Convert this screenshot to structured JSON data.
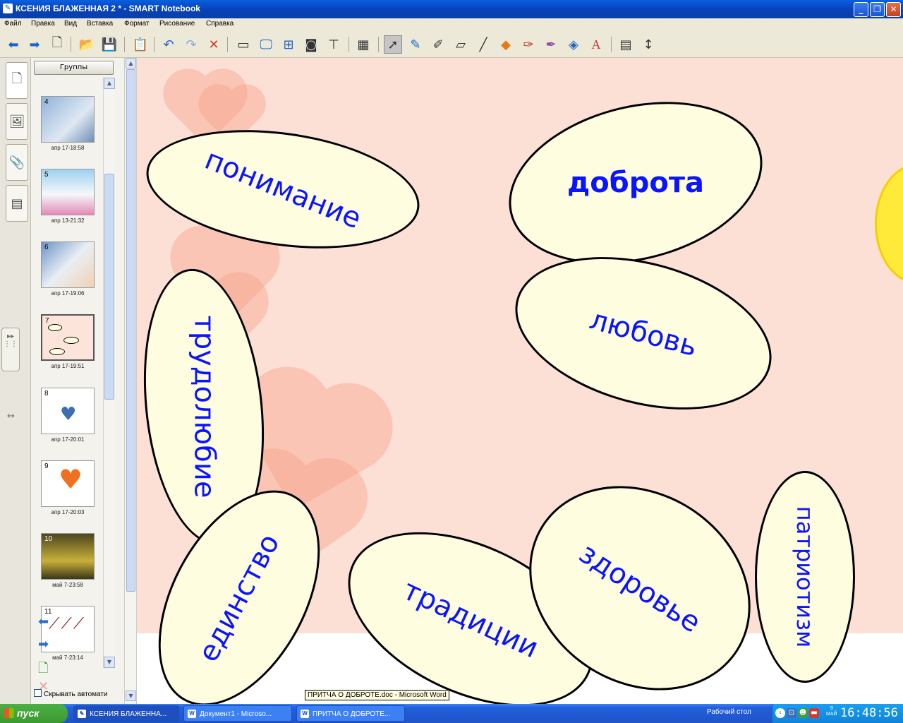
{
  "window": {
    "title": "КСЕНИЯ БЛАЖЕННАЯ 2 * - SMART Notebook",
    "buttons": [
      "_",
      "❐",
      "✕"
    ]
  },
  "menu": [
    "Файл",
    "Правка",
    "Вид",
    "Вставка",
    "Формат",
    "Рисование",
    "Справка"
  ],
  "toolbar": {
    "icons": [
      "back-arrow-icon",
      "forward-arrow-icon",
      "add-page-icon",
      "open-folder-icon",
      "save-icon",
      "paste-icon",
      "undo-icon",
      "redo-icon",
      "delete-icon",
      "screen-shade-icon",
      "full-screen-icon",
      "dual-page-icon",
      "capture-icon",
      "document-camera-icon",
      "table-icon",
      "select-icon",
      "pen-icon",
      "creative-pen-icon",
      "eraser-icon",
      "line-icon",
      "shape-icon",
      "magic-pen-icon",
      "recognition-pen-icon",
      "fill-icon",
      "text-icon",
      "properties-icon",
      "move-toolbar-icon"
    ]
  },
  "sorter": {
    "groups_label": "Группы",
    "autohide_label": "Скрывать автомати",
    "pages": [
      {
        "num": "4",
        "date": "апр 17-18:58",
        "color": "#7fa2c8"
      },
      {
        "num": "5",
        "date": "апр 13-21:32",
        "color": "#c6dbe8"
      },
      {
        "num": "6",
        "date": "апр 17-19:06",
        "color": "#a9c2e0"
      },
      {
        "num": "7",
        "date": "апр 17-19:51",
        "color": "#fde4da"
      },
      {
        "num": "8",
        "date": "апр 17-20:01",
        "color": "#ffffff"
      },
      {
        "num": "9",
        "date": "апр 17-20:03",
        "color": "#ffffff"
      },
      {
        "num": "10",
        "date": "май 7-23:58",
        "color": "#3f3a20"
      },
      {
        "num": "11",
        "date": "май 7-23:14",
        "color": "#ffffff"
      }
    ]
  },
  "canvas": {
    "words": [
      "понимание",
      "доброта",
      "любовь",
      "трудолюбие",
      "единство",
      "традиции",
      "здоровье",
      "патриотизм"
    ]
  },
  "tooltip": "ПРИТЧА О ДОБРОТЕ.doc - Microsoft Word",
  "taskbar": {
    "start_label": "пуск",
    "tasks": [
      "КСЕНИЯ БЛАЖЕННА...",
      "Документ1 - Microso...",
      "ПРИТЧА О ДОБРОТЕ..."
    ],
    "desktop_label": "Рабочий стол",
    "day_label": "9\nМАЙ",
    "clock": "16:48:56"
  }
}
